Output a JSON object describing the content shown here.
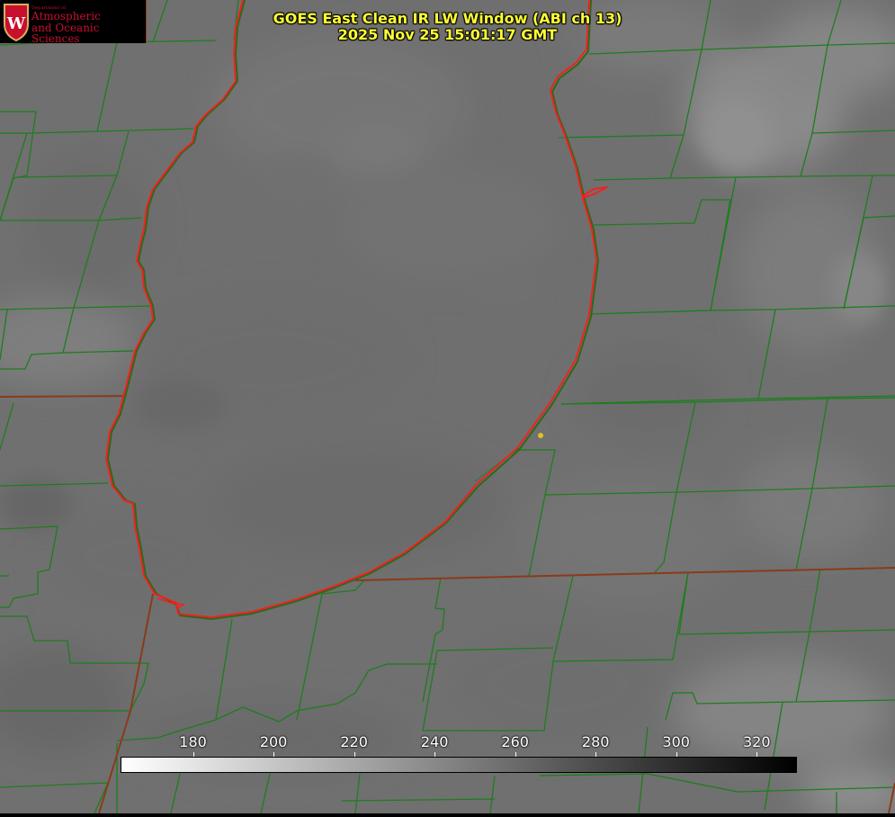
{
  "header": {
    "title_line1": "GOES East Clean IR LW Window (ABI ch 13)",
    "title_line2": "2025 Nov 25 15:01:17 GMT"
  },
  "logo": {
    "dept": "Department of",
    "line1": "Atmospheric",
    "line2": "and Oceanic Sciences",
    "crest_letter": "W"
  },
  "colorbar": {
    "ticks": [
      {
        "label": "180",
        "value": 180
      },
      {
        "label": "200",
        "value": 200
      },
      {
        "label": "220",
        "value": 220
      },
      {
        "label": "240",
        "value": 240
      },
      {
        "label": "260",
        "value": 260
      },
      {
        "label": "280",
        "value": 280
      },
      {
        "label": "300",
        "value": 300
      },
      {
        "label": "320",
        "value": 320
      }
    ],
    "range": [
      162,
      330
    ],
    "gradient_start": "#ffffff",
    "gradient_end": "#000000"
  },
  "colors": {
    "county_lines": "#1e7d1e",
    "shoreline": "#ff1a1a",
    "state_lines": "#8b3a1a",
    "title": "#ffff33",
    "station_dot": "#e0c020"
  }
}
